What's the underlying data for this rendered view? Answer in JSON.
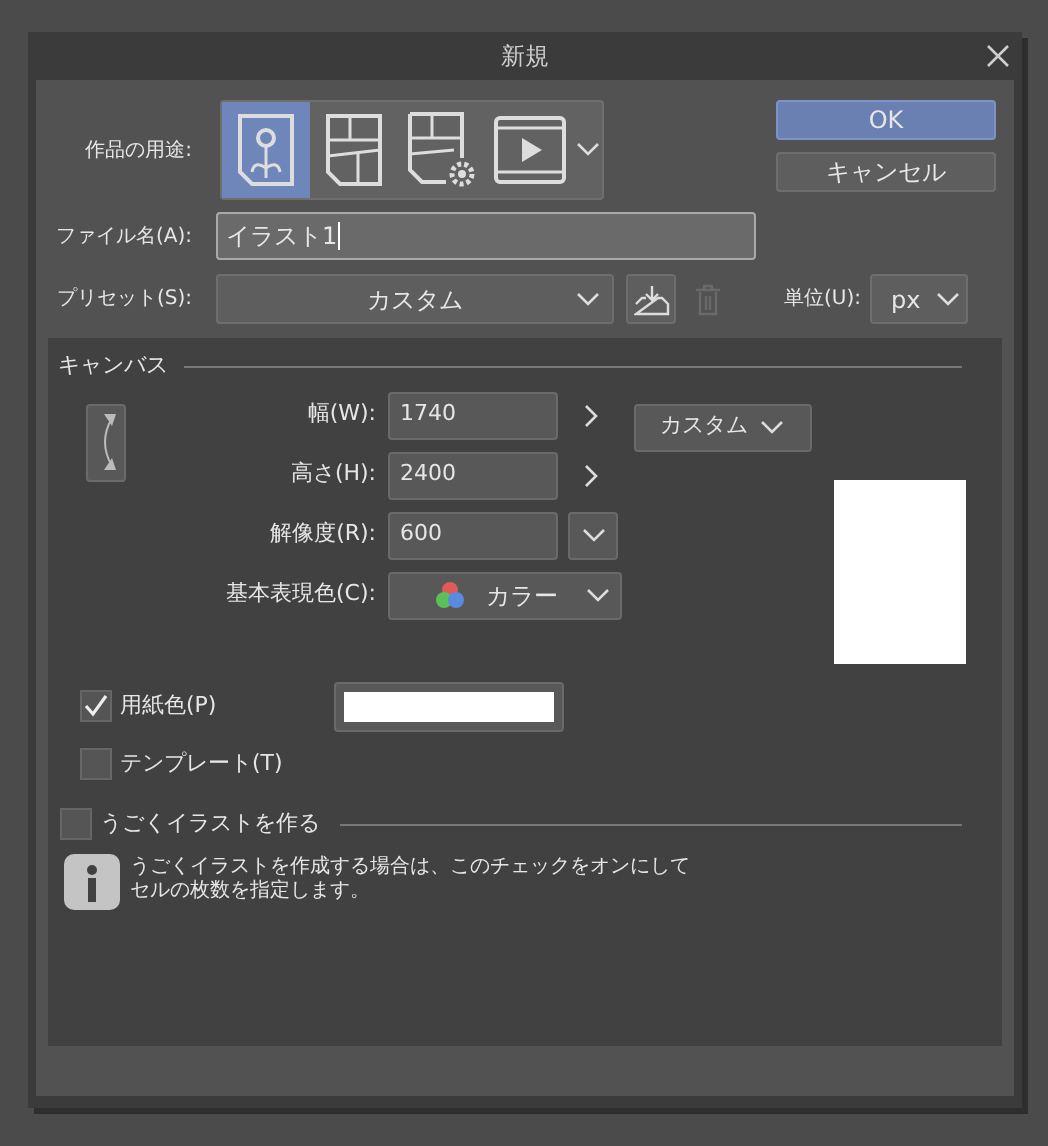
{
  "window": {
    "title": "新規"
  },
  "purpose": {
    "label": "作品の用途:",
    "options": [
      {
        "kind": "illustration",
        "selected": true
      },
      {
        "kind": "comic",
        "selected": false
      },
      {
        "kind": "comic-settings",
        "selected": false
      },
      {
        "kind": "animation",
        "selected": false
      }
    ]
  },
  "buttons": [
    {
      "label": "OK",
      "kind": "primary"
    },
    {
      "label": "キャンセル",
      "kind": "secondary"
    }
  ],
  "file_name": {
    "label": "ファイル名(A):",
    "value": "イラスト1"
  },
  "preset": {
    "label": "プリセット(S):",
    "value": "カスタム",
    "delete_disabled": true
  },
  "unit": {
    "label": "単位(U):",
    "value": "px"
  },
  "canvas": {
    "title": "キャンバス",
    "fields": [
      {
        "label": "幅(W):",
        "value": "1740",
        "kind": "link"
      },
      {
        "label": "高さ(H):",
        "value": "2400",
        "kind": "link"
      },
      {
        "label": "解像度(R):",
        "value": "600",
        "kind": "dropdown"
      }
    ],
    "size_preset": "カスタム",
    "color_mode": {
      "label": "基本表現色(C):",
      "value": "カラー"
    },
    "paper_color": {
      "label": "用紙色(P)",
      "checked": true,
      "color": "#ffffff"
    },
    "template": {
      "label": "テンプレート(T)",
      "checked": false
    }
  },
  "animation": {
    "label": "うごくイラストを作る",
    "checked": false,
    "info": [
      "うごくイラストを作成する場合は、このチェックをオンにして",
      "セルの枚数を指定します。"
    ]
  }
}
